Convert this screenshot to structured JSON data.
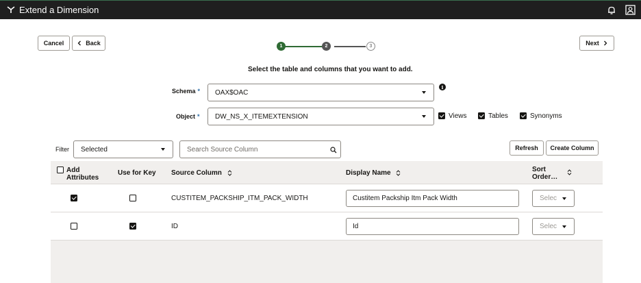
{
  "header": {
    "title": "Extend a Dimension",
    "logo_icon": "oracle-analytics-logo",
    "bell_icon": "bell-icon",
    "user_icon": "user-profile-icon",
    "background": "#1f1f1f"
  },
  "nav": {
    "cancel_label": "Cancel",
    "back_label": "Back",
    "next_label": "Next"
  },
  "train": {
    "steps": [
      {
        "number": "1",
        "state": "completed"
      },
      {
        "number": "2",
        "state": "current"
      },
      {
        "number": "3",
        "state": "pending"
      }
    ],
    "accent": "#2f6b34"
  },
  "instructions": "Select the table and columns that you want to add.",
  "form": {
    "schema_label": "Schema",
    "schema_value": "OAX$OAC",
    "object_label": "Object",
    "object_value": "DW_NS_X_ITEMEXTENSION",
    "required_marker": "*",
    "info_icon_glyph": "i",
    "object_types": [
      {
        "label": "Views",
        "checked": true
      },
      {
        "label": "Tables",
        "checked": true
      },
      {
        "label": "Synonyms",
        "checked": true
      }
    ]
  },
  "toolbar": {
    "filter_label": "Filter",
    "filter_value": "Selected",
    "search_placeholder": "Search Source Column",
    "refresh_label": "Refresh",
    "create_column_label": "Create Column"
  },
  "table": {
    "headers": {
      "add_attributes_line1": "Add",
      "add_attributes_line2": "Attributes",
      "use_for_key": "Use for Key",
      "source_column": "Source Column",
      "display_name": "Display Name",
      "sort_order_line1": "Sort",
      "sort_order_line2": "Order…"
    },
    "rows": [
      {
        "add_attribute": true,
        "use_for_key": false,
        "source_column": "CUSTITEM_PACKSHIP_ITM_PACK_WIDTH",
        "display_name": "Custitem Packship Itm Pack Width",
        "sort_order": "Selec"
      },
      {
        "add_attribute": false,
        "use_for_key": true,
        "source_column": "ID",
        "display_name": "Id",
        "sort_order": "Selec"
      }
    ]
  }
}
